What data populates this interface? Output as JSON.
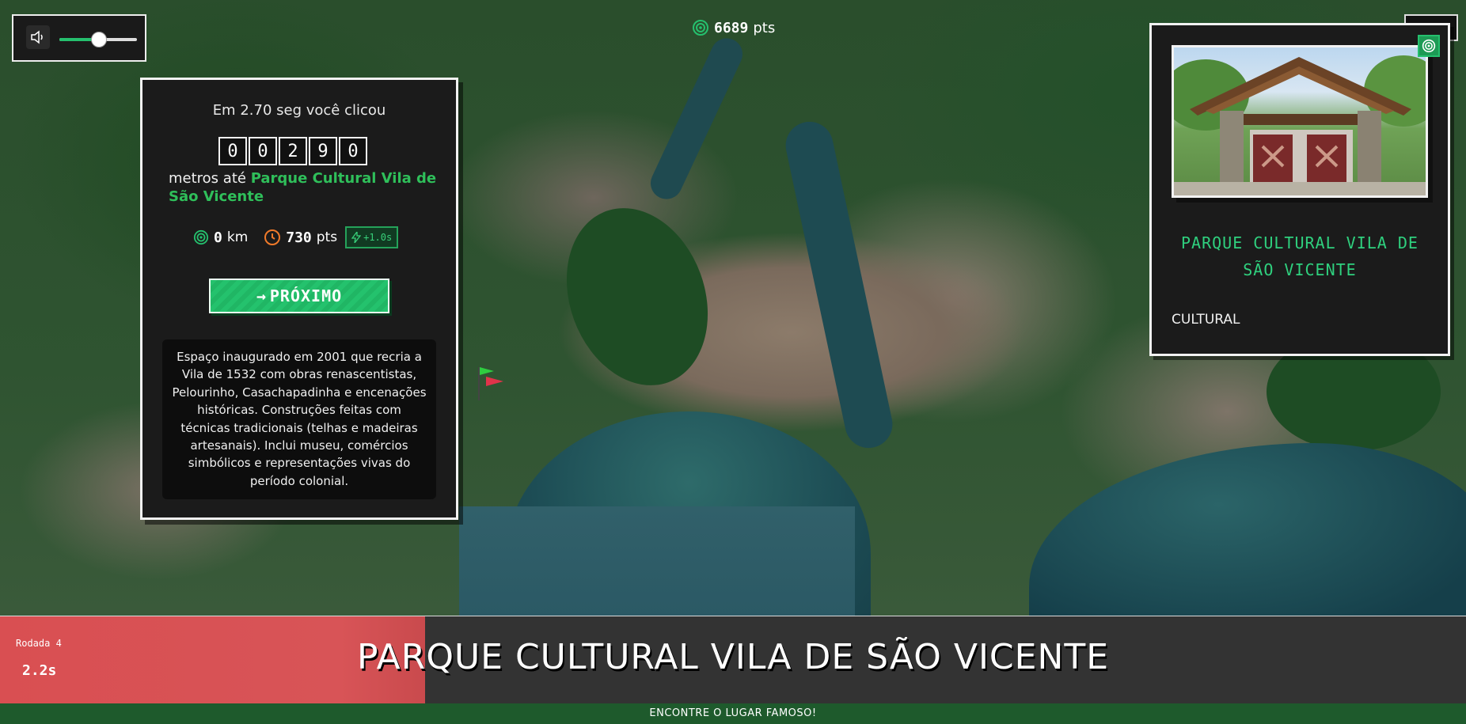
{
  "audio": {
    "volume_percent": 50
  },
  "score": {
    "value": "6689",
    "unit": "pts"
  },
  "result": {
    "time_text": "Em 2.70 seg você clicou",
    "digits": [
      "0",
      "0",
      "2",
      "9",
      "0"
    ],
    "meters_prefix": "metros até",
    "place": "Parque Cultural Vila de São Vicente",
    "distance": {
      "value": "0",
      "unit": "km"
    },
    "points": {
      "value": "730",
      "unit": "pts"
    },
    "bonus": "+1.0s",
    "next_label": "PRÓXIMO",
    "description": "Espaço inaugurado em 2001 que recria a Vila de 1532 com obras renascentistas, Pelourinho, Casachapadinha e encenações históricas. Construções feitas com técnicas tradicionais (telhas e madeiras artesanais). Inclui museu, comércios simbólicos e representações vivas do período colonial."
  },
  "card": {
    "title": "PARQUE CULTURAL VILA DE SÃO VICENTE",
    "category": "CULTURAL"
  },
  "bar": {
    "round_label": "Rodada 4",
    "seconds": "2.2s",
    "time_remaining_fraction": 0.29,
    "title": "PARQUE CULTURAL VILA DE SÃO VICENTE"
  },
  "footer": {
    "text": "ENCONTRE O LUGAR FAMOSO!"
  },
  "colors": {
    "accent_green": "#25c06e",
    "timer_red": "#d94f52",
    "panel_bg": "#1b1b1b"
  }
}
